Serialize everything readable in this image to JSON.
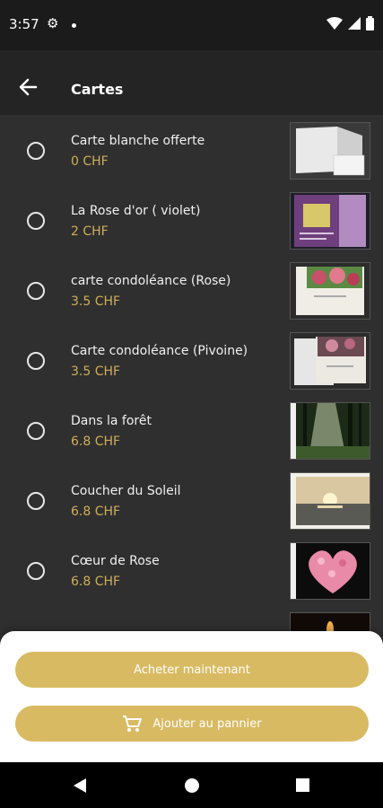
{
  "status": {
    "time": "3:57"
  },
  "appbar": {
    "title": "Cartes"
  },
  "cards": [
    {
      "name": "Carte blanche offerte",
      "price": "0 CHF"
    },
    {
      "name": "La Rose d'or ( violet)",
      "price": "2 CHF"
    },
    {
      "name": "carte condoléance (Rose)",
      "price": "3.5 CHF"
    },
    {
      "name": "Carte condoléance (Pivoine)",
      "price": "3.5 CHF"
    },
    {
      "name": "Dans la forêt",
      "price": "6.8 CHF"
    },
    {
      "name": "Coucher du Soleil",
      "price": "6.8 CHF"
    },
    {
      "name": "Cœur de Rose",
      "price": "6.8 CHF"
    }
  ],
  "actions": {
    "buy_now": "Acheter maintenant",
    "add_to_cart": "Ajouter au pannier"
  },
  "colors": {
    "accent": "#d8ba62",
    "price": "#cfae5b",
    "background": "#2f2f2f",
    "appbar": "#242424"
  }
}
